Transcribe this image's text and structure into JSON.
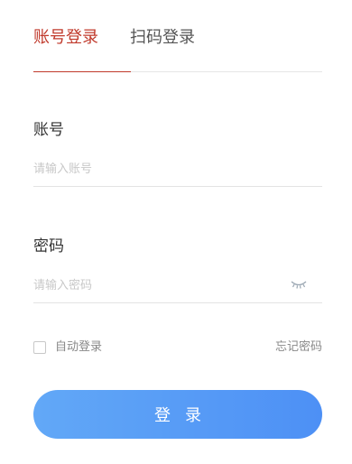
{
  "tabs": [
    {
      "label": "账号登录",
      "active": true
    },
    {
      "label": "扫码登录",
      "active": false
    }
  ],
  "account": {
    "label": "账号",
    "placeholder": "请输入账号",
    "value": ""
  },
  "password": {
    "label": "密码",
    "placeholder": "请输入密码",
    "value": "",
    "toggle_icon": "eye-closed-icon"
  },
  "options": {
    "auto_login_label": "自动登录",
    "auto_login_checked": false,
    "forgot_label": "忘记密码"
  },
  "submit_label": "登录",
  "colors": {
    "accent": "#c0392b",
    "button_start": "#62a8f7",
    "button_end": "#4d90f5",
    "placeholder": "#c8c8c8",
    "divider": "#e3e3e3"
  }
}
